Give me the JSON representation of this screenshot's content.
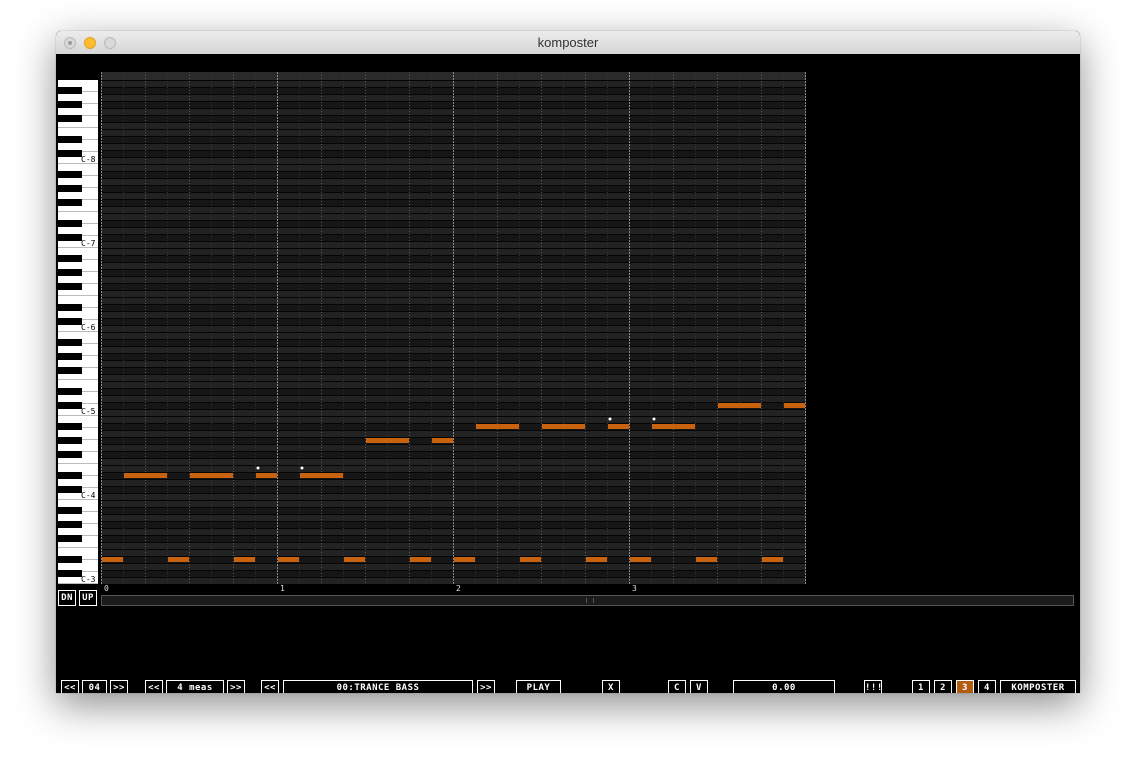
{
  "window": {
    "title": "komposter"
  },
  "piano": {
    "octave_labels": [
      "C-8",
      "C-7",
      "C-6",
      "C-5",
      "C-4",
      "C-3"
    ]
  },
  "ruler": {
    "measure_labels": [
      "0",
      "1",
      "2",
      "3"
    ]
  },
  "notes": {
    "color": "#c8620f",
    "upper_line": [
      {
        "pitch": "D#4",
        "step": 1,
        "length": 2
      },
      {
        "pitch": "D#4",
        "step": 4,
        "length": 2
      },
      {
        "pitch": "D#4",
        "step": 7,
        "length": 1,
        "slide": true
      },
      {
        "pitch": "D#4",
        "step": 9,
        "length": 2,
        "slide": true
      },
      {
        "pitch": "G#4",
        "step": 12,
        "length": 2
      },
      {
        "pitch": "G#4",
        "step": 15,
        "length": 1
      },
      {
        "pitch": "A#4",
        "step": 17,
        "length": 2
      },
      {
        "pitch": "A#4",
        "step": 20,
        "length": 2
      },
      {
        "pitch": "A#4",
        "step": 23,
        "length": 1,
        "slide": true
      },
      {
        "pitch": "A#4",
        "step": 25,
        "length": 2,
        "slide": true
      },
      {
        "pitch": "C#5",
        "step": 28,
        "length": 2
      },
      {
        "pitch": "C#5",
        "step": 31,
        "length": 1
      }
    ],
    "bass_line": [
      {
        "pitch": "D#3",
        "step": 0,
        "length": 1
      },
      {
        "pitch": "D#3",
        "step": 3,
        "length": 1
      },
      {
        "pitch": "D#3",
        "step": 6,
        "length": 1
      },
      {
        "pitch": "D#3",
        "step": 8,
        "length": 1
      },
      {
        "pitch": "D#3",
        "step": 11,
        "length": 1
      },
      {
        "pitch": "D#3",
        "step": 14,
        "length": 1
      },
      {
        "pitch": "D#3",
        "step": 16,
        "length": 1
      },
      {
        "pitch": "D#3",
        "step": 19,
        "length": 1
      },
      {
        "pitch": "D#3",
        "step": 22,
        "length": 1
      },
      {
        "pitch": "D#3",
        "step": 24,
        "length": 1
      },
      {
        "pitch": "D#3",
        "step": 27,
        "length": 1
      },
      {
        "pitch": "D#3",
        "step": 30,
        "length": 1
      }
    ]
  },
  "octave_buttons": {
    "down": "DN",
    "up": "UP"
  },
  "toolbar": {
    "octave": {
      "prev": "<<",
      "value": "04",
      "next": ">>"
    },
    "length": {
      "prev": "<<",
      "value": "4 meas",
      "next": ">>"
    },
    "instrument": {
      "prev": "<<",
      "value": "00:TRANCE BASS",
      "next": ">>"
    },
    "play": "PLAY",
    "close": "X",
    "copy": "C",
    "paste": "V",
    "value_field": "0.00",
    "grid_toggle": "!!!",
    "pages": [
      "1",
      "2",
      "3",
      "4"
    ],
    "active_page": "3",
    "app_button": "KOMPOSTER"
  },
  "colors": {
    "accent": "#c8620f",
    "background": "#000000",
    "grid_line": "#3a3a3a"
  }
}
